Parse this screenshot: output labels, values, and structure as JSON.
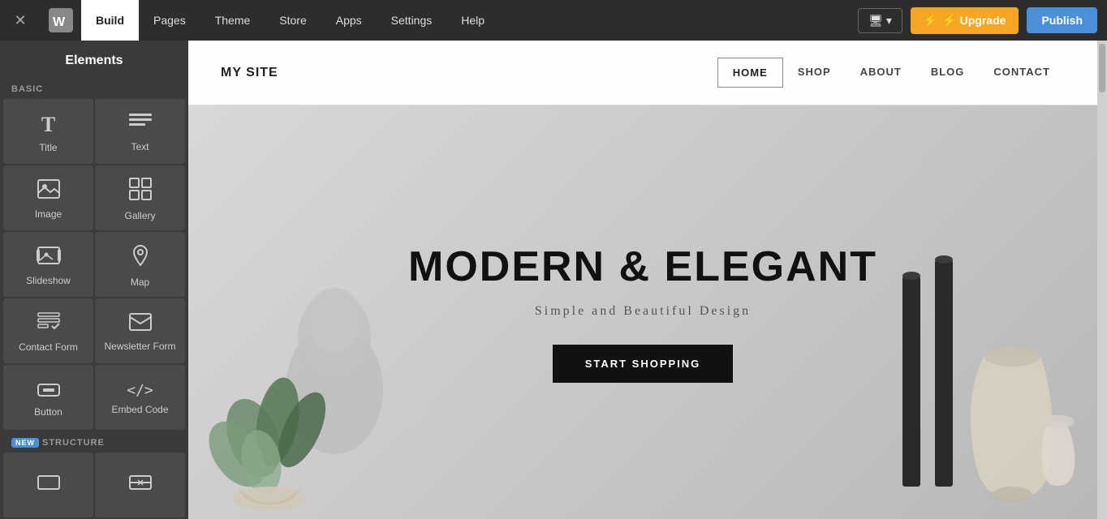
{
  "topNav": {
    "closeLabel": "×",
    "logoAlt": "Weebly",
    "items": [
      {
        "label": "Build",
        "active": true
      },
      {
        "label": "Pages",
        "active": false
      },
      {
        "label": "Theme",
        "active": false
      },
      {
        "label": "Store",
        "active": false
      },
      {
        "label": "Apps",
        "active": false
      },
      {
        "label": "Settings",
        "active": false
      },
      {
        "label": "Help",
        "active": false
      }
    ],
    "deviceLabel": "🖥 ▾",
    "upgradeLabel": "⚡ Upgrade",
    "publishLabel": "Publish"
  },
  "sidebar": {
    "title": "Elements",
    "sections": [
      {
        "label": "BASIC",
        "isNew": false,
        "elements": [
          {
            "name": "title",
            "label": "Title",
            "icon": "T"
          },
          {
            "name": "text",
            "label": "Text",
            "icon": "≡"
          },
          {
            "name": "image",
            "label": "Image",
            "icon": "🖼"
          },
          {
            "name": "gallery",
            "label": "Gallery",
            "icon": "⊞"
          },
          {
            "name": "slideshow",
            "label": "Slideshow",
            "icon": "🖼+"
          },
          {
            "name": "map",
            "label": "Map",
            "icon": "📍"
          },
          {
            "name": "contact-form",
            "label": "Contact Form",
            "icon": "☑"
          },
          {
            "name": "newsletter-form",
            "label": "Newsletter Form",
            "icon": "✉"
          },
          {
            "name": "button",
            "label": "Button",
            "icon": "▬"
          },
          {
            "name": "embed-code",
            "label": "Embed Code",
            "icon": "</>"
          }
        ]
      },
      {
        "label": "STRUCTURE",
        "isNew": true,
        "elements": [
          {
            "name": "section",
            "label": "",
            "icon": "▭"
          },
          {
            "name": "divider",
            "label": "",
            "icon": "⊟"
          }
        ]
      }
    ]
  },
  "sitePreview": {
    "logoText": "MY SITE",
    "navLinks": [
      {
        "label": "HOME",
        "active": true
      },
      {
        "label": "SHOP",
        "active": false
      },
      {
        "label": "ABOUT",
        "active": false
      },
      {
        "label": "BLOG",
        "active": false
      },
      {
        "label": "CONTACT",
        "active": false
      }
    ],
    "heroTitle": "MODERN & ELEGANT",
    "heroSubtitle": "Simple and Beautiful Design",
    "heroCTA": "START SHOPPING"
  }
}
